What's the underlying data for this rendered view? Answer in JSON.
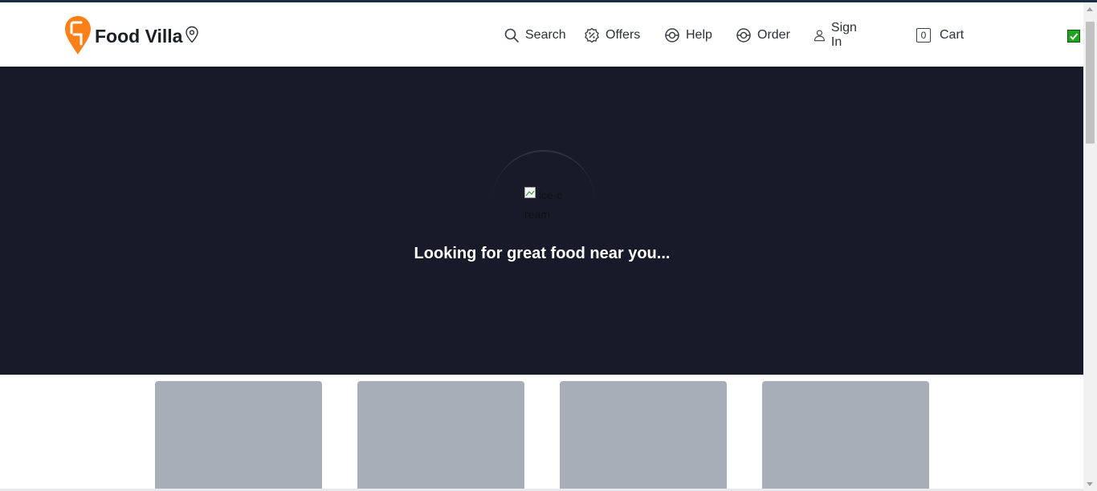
{
  "brand": {
    "name": "Food Villa",
    "logo_icon": "swiggy-logo-icon",
    "location_icon": "map-pin-icon",
    "accent": "#fc8019"
  },
  "nav": {
    "items": [
      {
        "label": "Search",
        "icon": "search-icon"
      },
      {
        "label": "Offers",
        "icon": "offers-percent-icon"
      },
      {
        "label": "Help",
        "icon": "help-lifebuoy-icon"
      },
      {
        "label": "Order",
        "icon": "order-icon"
      },
      {
        "label": "Sign In",
        "icon": "user-icon"
      }
    ],
    "cart": {
      "label": "Cart",
      "count": "0"
    }
  },
  "hero": {
    "background": "#171b29",
    "image_alt": "ice-cream",
    "message": "Looking for great food near you..."
  },
  "shimmer_cards": {
    "count": 4,
    "color": "#a8aeb7"
  },
  "extension": {
    "icon": "check-icon",
    "color": "#1ea41e"
  }
}
